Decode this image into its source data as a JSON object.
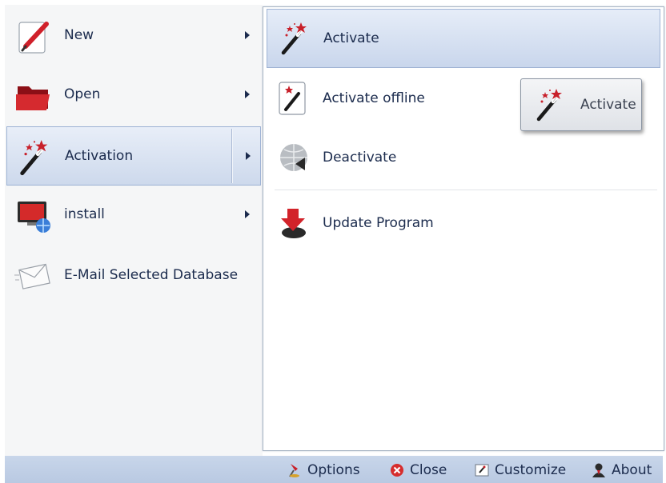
{
  "left_menu": {
    "items": [
      {
        "label": "New",
        "icon": "pencil-document-icon",
        "has_submenu": true
      },
      {
        "label": "Open",
        "icon": "folder-icon",
        "has_submenu": true
      },
      {
        "label": "Activation",
        "icon": "magic-wand-icon",
        "has_submenu": true,
        "selected": true
      },
      {
        "label": "install",
        "icon": "monitor-globe-icon",
        "has_submenu": true
      },
      {
        "label": "E-Mail Selected Database",
        "icon": "envelope-icon",
        "has_submenu": false
      }
    ]
  },
  "submenu": {
    "items": [
      {
        "label": "Activate",
        "icon": "magic-wand-icon",
        "selected": true
      },
      {
        "label": "Activate offline",
        "icon": "wand-document-icon"
      },
      {
        "label": "Deactivate",
        "icon": "grey-globe-icon"
      },
      {
        "label": "Update Program",
        "icon": "update-download-icon"
      }
    ]
  },
  "floating_button": {
    "label": "Activate",
    "icon": "magic-wand-icon"
  },
  "bottom_bar": {
    "items": [
      {
        "label": "Options",
        "icon": "pin-icon"
      },
      {
        "label": "Close",
        "icon": "close-circle-icon"
      },
      {
        "label": "Customize",
        "icon": "customize-icon"
      },
      {
        "label": "About",
        "icon": "person-icon"
      }
    ]
  },
  "colors": {
    "accent": "#c9d6ec",
    "text": "#1b2b4d",
    "bottom_bar": "#c0cfe6"
  }
}
